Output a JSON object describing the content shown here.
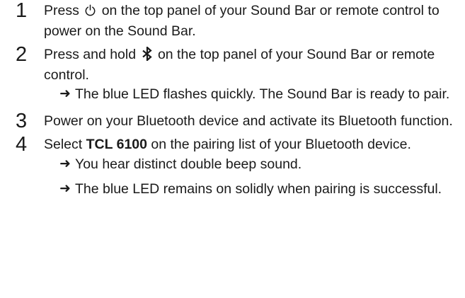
{
  "steps": [
    {
      "number": "1",
      "text_before_icon": "Press",
      "icon": "power-icon",
      "text_after_icon": "on the top panel of your Sound Bar or remote control to power on the Sound Bar."
    },
    {
      "number": "2",
      "text_before_icon": "Press and hold",
      "icon": "bluetooth-icon",
      "text_after_icon": "on the top panel of your Sound Bar or remote control.",
      "results": [
        "The blue LED flashes quickly. The Sound Bar is ready to pair."
      ]
    },
    {
      "number": "3",
      "text": "Power on your Bluetooth device and activate its Bluetooth function."
    },
    {
      "number": "4",
      "text_before_bold": "Select",
      "bold": "TCL 6100",
      "text_after_bold": "on the pairing list of your Bluetooth device.",
      "results": [
        "You hear distinct double beep sound.",
        "The blue LED remains on solidly when pairing is successful."
      ]
    }
  ],
  "arrow_glyph": "➜"
}
